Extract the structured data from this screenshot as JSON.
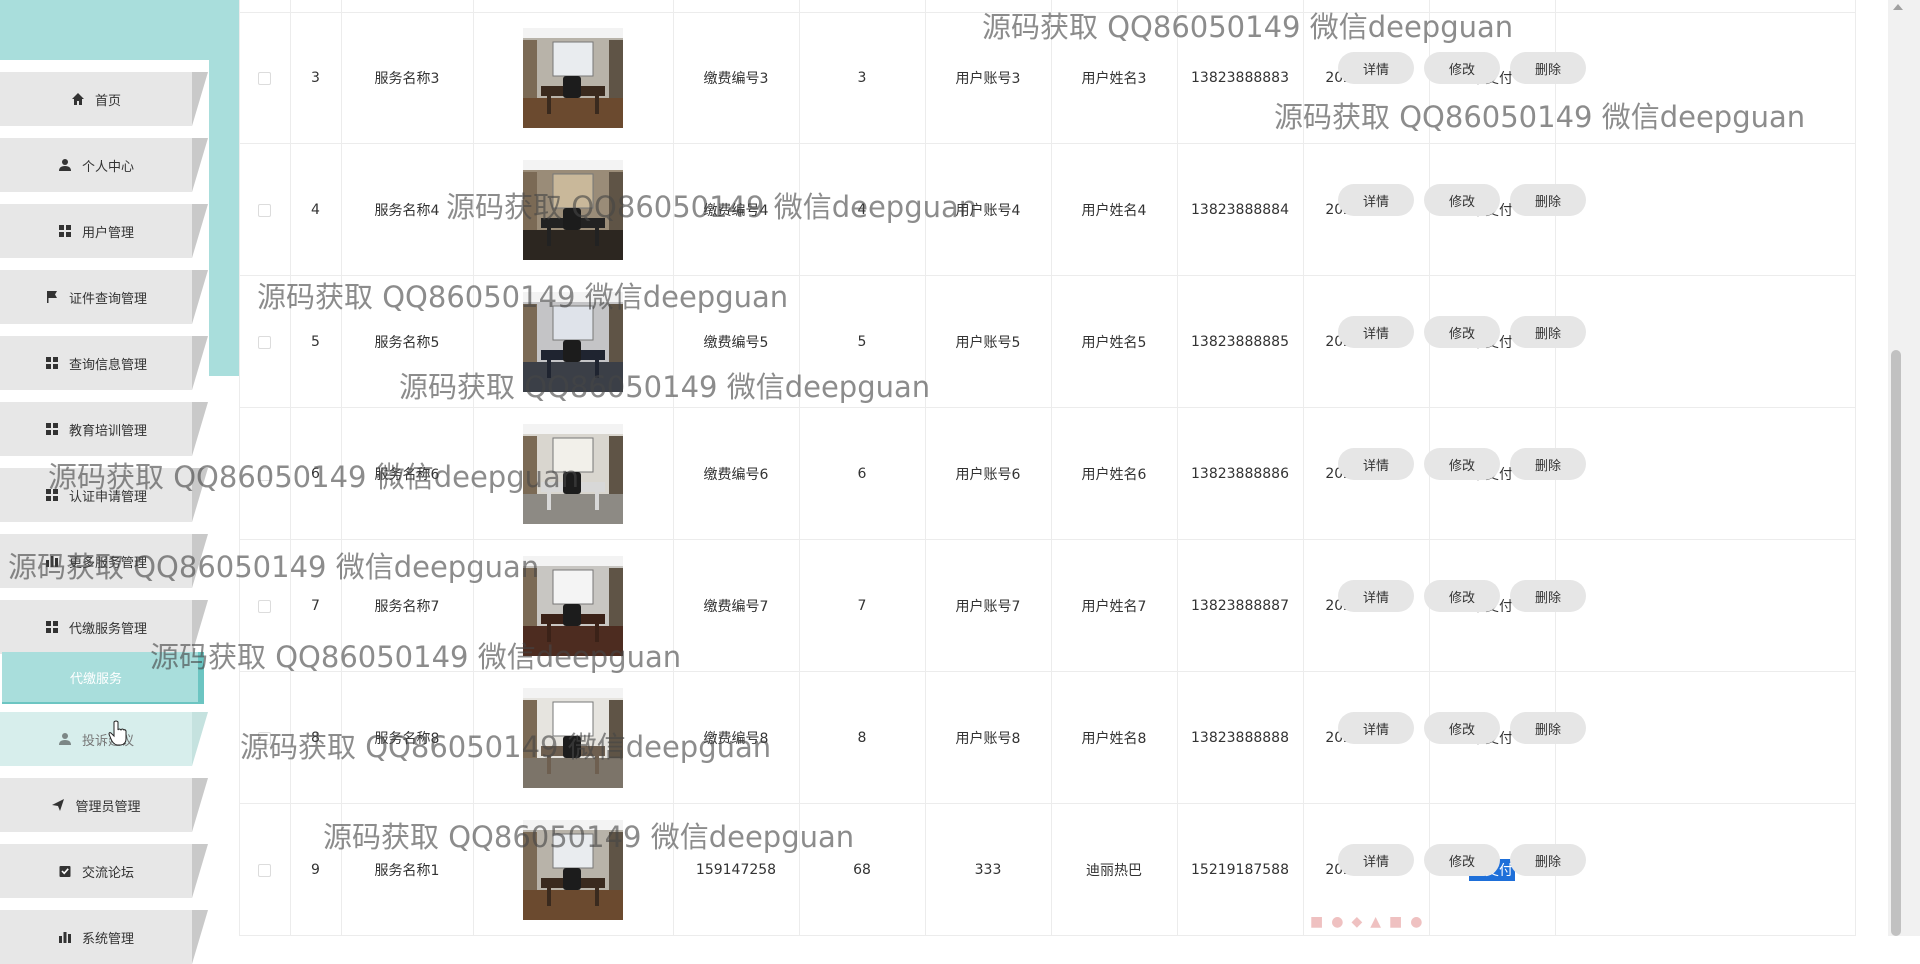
{
  "sidebar": {
    "items": [
      {
        "label": "首页",
        "icon": "home-icon"
      },
      {
        "label": "个人中心",
        "icon": "user-icon"
      },
      {
        "label": "用户管理",
        "icon": "grid-icon"
      },
      {
        "label": "证件查询管理",
        "icon": "flag-icon"
      },
      {
        "label": "查询信息管理",
        "icon": "grid-icon"
      },
      {
        "label": "教育培训管理",
        "icon": "grid-icon"
      },
      {
        "label": "认证申请管理",
        "icon": "grid-icon"
      },
      {
        "label": "更多服务管理",
        "icon": "bars-icon"
      },
      {
        "label": "代缴服务管理",
        "icon": "grid-icon"
      },
      {
        "label": "投诉建议",
        "icon": "user-icon"
      },
      {
        "label": "管理员管理",
        "icon": "send-icon"
      },
      {
        "label": "交流论坛",
        "icon": "check-icon"
      },
      {
        "label": "系统管理",
        "icon": "bars-icon"
      }
    ],
    "sub_item": "代缴服务"
  },
  "table": {
    "rows": [
      {
        "index": "3",
        "service_name": "服务名称3",
        "payment_no": "缴费编号3",
        "amount": "3",
        "account": "用户账号3",
        "user_name": "用户姓名3",
        "phone": "13823888883",
        "date": "2023-01-25",
        "status": "未支付",
        "paid": false
      },
      {
        "index": "4",
        "service_name": "服务名称4",
        "payment_no": "缴费编号4",
        "amount": "4",
        "account": "用户账号4",
        "user_name": "用户姓名4",
        "phone": "13823888884",
        "date": "2023-01-25",
        "status": "未支付",
        "paid": false
      },
      {
        "index": "5",
        "service_name": "服务名称5",
        "payment_no": "缴费编号5",
        "amount": "5",
        "account": "用户账号5",
        "user_name": "用户姓名5",
        "phone": "13823888885",
        "date": "2023-01-25",
        "status": "未支付",
        "paid": false
      },
      {
        "index": "6",
        "service_name": "服务名称6",
        "payment_no": "缴费编号6",
        "amount": "6",
        "account": "用户账号6",
        "user_name": "用户姓名6",
        "phone": "13823888886",
        "date": "2023-01-25",
        "status": "未支付",
        "paid": false
      },
      {
        "index": "7",
        "service_name": "服务名称7",
        "payment_no": "缴费编号7",
        "amount": "7",
        "account": "用户账号7",
        "user_name": "用户姓名7",
        "phone": "13823888887",
        "date": "2023-01-25",
        "status": "未支付",
        "paid": false
      },
      {
        "index": "8",
        "service_name": "服务名称8",
        "payment_no": "缴费编号8",
        "amount": "8",
        "account": "用户账号8",
        "user_name": "用户姓名8",
        "phone": "13823888888",
        "date": "2023-01-25",
        "status": "未支付",
        "paid": false
      },
      {
        "index": "9",
        "service_name": "服务名称1",
        "payment_no": "159147258",
        "amount": "68",
        "account": "333",
        "user_name": "迪丽热巴",
        "phone": "15219187588",
        "date": "2023-01-25",
        "status": "已支付",
        "paid": true
      }
    ],
    "actions": {
      "detail": "详情",
      "edit": "修改",
      "delete": "删除"
    }
  },
  "watermark": "源码获取 QQ86050149 微信deepguan",
  "colors": {
    "accent": "#a9dedc",
    "accent_dark": "#6cc5c2",
    "button_bg": "#e6e6e6",
    "selection": "#1e6fd9"
  }
}
